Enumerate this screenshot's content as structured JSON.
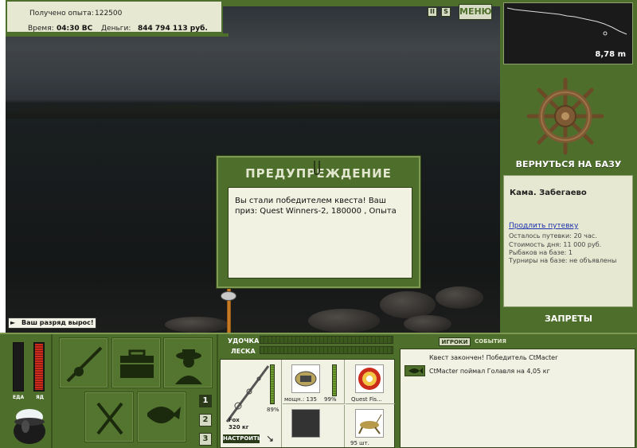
{
  "info": {
    "exp_label": "Получено опыта:",
    "exp_value": "122500",
    "time_label": "Время:",
    "time_value": "04:30 ВС",
    "money_label": "Деньги:",
    "money_value": "844 794 113 руб."
  },
  "controls": {
    "pause": "II",
    "sound": "S",
    "menu": "МЕНЮ"
  },
  "depth": {
    "value": "8,78 m",
    "profile": [
      0,
      2,
      3,
      4,
      5,
      6,
      7,
      8,
      10,
      11,
      13,
      15,
      17,
      20,
      24,
      29,
      33
    ]
  },
  "base": {
    "return_label": "ВЕРНУТЬСЯ НА БАЗУ",
    "title": "Кама. Забегаево",
    "extend_link": "Продлить путевку",
    "remaining": "Осталось путевки: 20 час.",
    "day_cost": "Стоимость дня: 11 000 руб.",
    "fishers": "Рыбаков на базе: 1",
    "tournaments": "Турниры на базе: не объявлены",
    "bans_label": "ЗАПРЕТЫ"
  },
  "dialog": {
    "title": "ПРЕДУПРЕЖДЕНИЕ",
    "message": "Вы стали победителем квеста! Ваш приз: Quest Winners-2, 180000 , Опыта"
  },
  "notification": {
    "rank": "Ваш разряд вырос!"
  },
  "player": {
    "food_label": "ЕДА",
    "drink_label": "ЯД",
    "food_level": 0.0,
    "drink_level": 1.0
  },
  "tackle": {
    "rod_label": "УДОЧКА",
    "line_label": "ЛЕСКА",
    "rod_name": "Fox",
    "rod_weight": "320 кг",
    "rod_percent": "89%",
    "rod_level": 0.89,
    "reel_power": "мощн.: 135",
    "reel_percent": "99%",
    "reel_level": 0.99,
    "line_name": "Quest Fis...",
    "bait_count": "95 шт.",
    "setup_label": "НАСТРОИТЬ",
    "set_numbers": [
      "1",
      "2",
      "3"
    ]
  },
  "chat": {
    "tab_players": "ИГРОКИ",
    "tab_events": "СОБЫТИЯ",
    "line1": "Квест закончен! Победитель CtMacter",
    "line2": "CtMacter поймал Голавля на 4,05 кг"
  },
  "colors": {
    "frame_green": "#4e6f2b",
    "panel_cream": "#e7e8d1",
    "meter_red": "#cc2a1b"
  }
}
